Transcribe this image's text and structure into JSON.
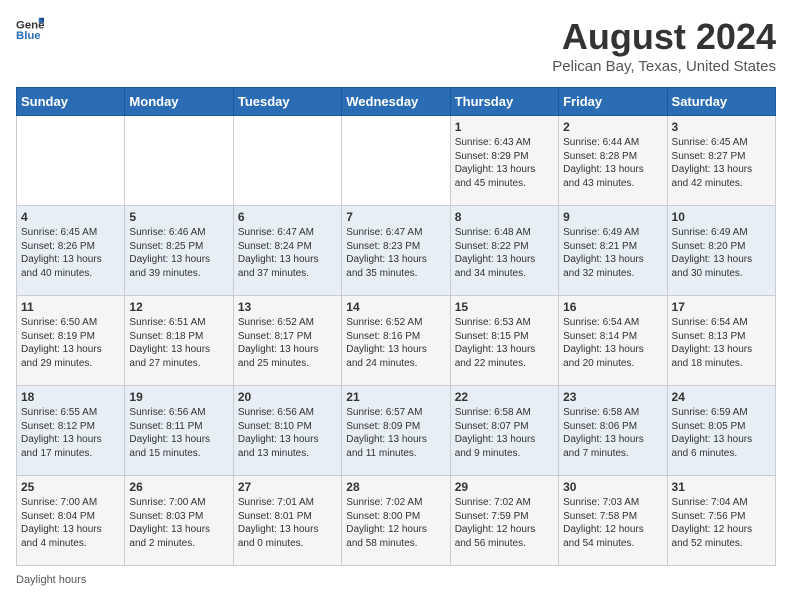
{
  "logo": {
    "general": "General",
    "blue": "Blue"
  },
  "title": "August 2024",
  "subtitle": "Pelican Bay, Texas, United States",
  "days_of_week": [
    "Sunday",
    "Monday",
    "Tuesday",
    "Wednesday",
    "Thursday",
    "Friday",
    "Saturday"
  ],
  "weeks": [
    [
      {
        "day": "",
        "info": ""
      },
      {
        "day": "",
        "info": ""
      },
      {
        "day": "",
        "info": ""
      },
      {
        "day": "",
        "info": ""
      },
      {
        "day": "1",
        "info": "Sunrise: 6:43 AM\nSunset: 8:29 PM\nDaylight: 13 hours and 45 minutes."
      },
      {
        "day": "2",
        "info": "Sunrise: 6:44 AM\nSunset: 8:28 PM\nDaylight: 13 hours and 43 minutes."
      },
      {
        "day": "3",
        "info": "Sunrise: 6:45 AM\nSunset: 8:27 PM\nDaylight: 13 hours and 42 minutes."
      }
    ],
    [
      {
        "day": "4",
        "info": "Sunrise: 6:45 AM\nSunset: 8:26 PM\nDaylight: 13 hours and 40 minutes."
      },
      {
        "day": "5",
        "info": "Sunrise: 6:46 AM\nSunset: 8:25 PM\nDaylight: 13 hours and 39 minutes."
      },
      {
        "day": "6",
        "info": "Sunrise: 6:47 AM\nSunset: 8:24 PM\nDaylight: 13 hours and 37 minutes."
      },
      {
        "day": "7",
        "info": "Sunrise: 6:47 AM\nSunset: 8:23 PM\nDaylight: 13 hours and 35 minutes."
      },
      {
        "day": "8",
        "info": "Sunrise: 6:48 AM\nSunset: 8:22 PM\nDaylight: 13 hours and 34 minutes."
      },
      {
        "day": "9",
        "info": "Sunrise: 6:49 AM\nSunset: 8:21 PM\nDaylight: 13 hours and 32 minutes."
      },
      {
        "day": "10",
        "info": "Sunrise: 6:49 AM\nSunset: 8:20 PM\nDaylight: 13 hours and 30 minutes."
      }
    ],
    [
      {
        "day": "11",
        "info": "Sunrise: 6:50 AM\nSunset: 8:19 PM\nDaylight: 13 hours and 29 minutes."
      },
      {
        "day": "12",
        "info": "Sunrise: 6:51 AM\nSunset: 8:18 PM\nDaylight: 13 hours and 27 minutes."
      },
      {
        "day": "13",
        "info": "Sunrise: 6:52 AM\nSunset: 8:17 PM\nDaylight: 13 hours and 25 minutes."
      },
      {
        "day": "14",
        "info": "Sunrise: 6:52 AM\nSunset: 8:16 PM\nDaylight: 13 hours and 24 minutes."
      },
      {
        "day": "15",
        "info": "Sunrise: 6:53 AM\nSunset: 8:15 PM\nDaylight: 13 hours and 22 minutes."
      },
      {
        "day": "16",
        "info": "Sunrise: 6:54 AM\nSunset: 8:14 PM\nDaylight: 13 hours and 20 minutes."
      },
      {
        "day": "17",
        "info": "Sunrise: 6:54 AM\nSunset: 8:13 PM\nDaylight: 13 hours and 18 minutes."
      }
    ],
    [
      {
        "day": "18",
        "info": "Sunrise: 6:55 AM\nSunset: 8:12 PM\nDaylight: 13 hours and 17 minutes."
      },
      {
        "day": "19",
        "info": "Sunrise: 6:56 AM\nSunset: 8:11 PM\nDaylight: 13 hours and 15 minutes."
      },
      {
        "day": "20",
        "info": "Sunrise: 6:56 AM\nSunset: 8:10 PM\nDaylight: 13 hours and 13 minutes."
      },
      {
        "day": "21",
        "info": "Sunrise: 6:57 AM\nSunset: 8:09 PM\nDaylight: 13 hours and 11 minutes."
      },
      {
        "day": "22",
        "info": "Sunrise: 6:58 AM\nSunset: 8:07 PM\nDaylight: 13 hours and 9 minutes."
      },
      {
        "day": "23",
        "info": "Sunrise: 6:58 AM\nSunset: 8:06 PM\nDaylight: 13 hours and 7 minutes."
      },
      {
        "day": "24",
        "info": "Sunrise: 6:59 AM\nSunset: 8:05 PM\nDaylight: 13 hours and 6 minutes."
      }
    ],
    [
      {
        "day": "25",
        "info": "Sunrise: 7:00 AM\nSunset: 8:04 PM\nDaylight: 13 hours and 4 minutes."
      },
      {
        "day": "26",
        "info": "Sunrise: 7:00 AM\nSunset: 8:03 PM\nDaylight: 13 hours and 2 minutes."
      },
      {
        "day": "27",
        "info": "Sunrise: 7:01 AM\nSunset: 8:01 PM\nDaylight: 13 hours and 0 minutes."
      },
      {
        "day": "28",
        "info": "Sunrise: 7:02 AM\nSunset: 8:00 PM\nDaylight: 12 hours and 58 minutes."
      },
      {
        "day": "29",
        "info": "Sunrise: 7:02 AM\nSunset: 7:59 PM\nDaylight: 12 hours and 56 minutes."
      },
      {
        "day": "30",
        "info": "Sunrise: 7:03 AM\nSunset: 7:58 PM\nDaylight: 12 hours and 54 minutes."
      },
      {
        "day": "31",
        "info": "Sunrise: 7:04 AM\nSunset: 7:56 PM\nDaylight: 12 hours and 52 minutes."
      }
    ]
  ],
  "footer": "Daylight hours"
}
